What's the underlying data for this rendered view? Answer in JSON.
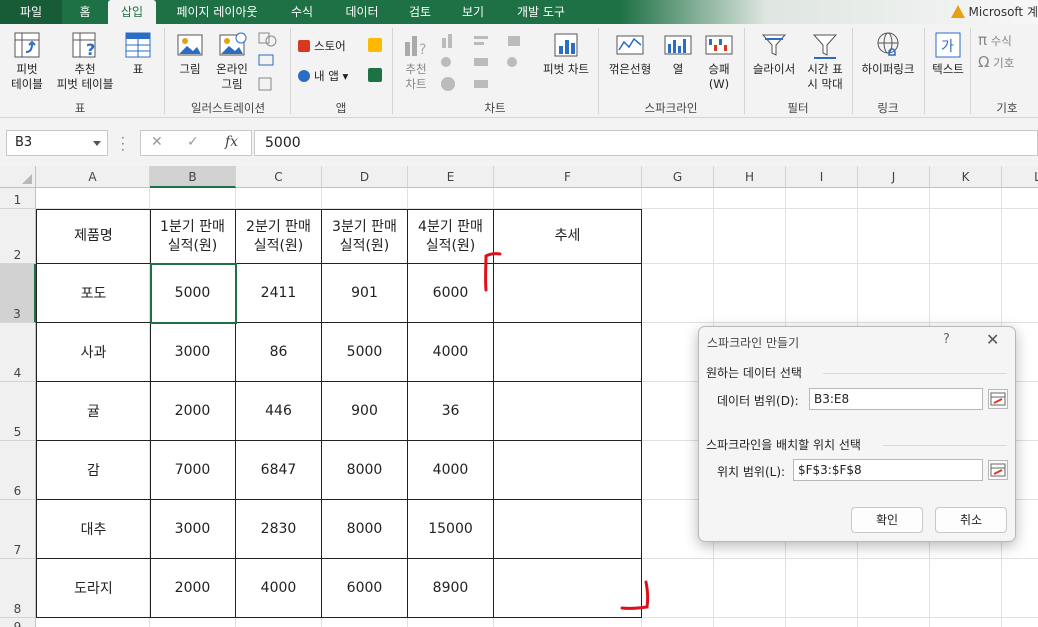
{
  "tabs": [
    {
      "label": "파일"
    },
    {
      "label": "홈"
    },
    {
      "label": "삽입"
    },
    {
      "label": "페이지 레이아웃"
    },
    {
      "label": "수식"
    },
    {
      "label": "데이터"
    },
    {
      "label": "검토"
    },
    {
      "label": "보기"
    },
    {
      "label": "개발 도구"
    }
  ],
  "active_tab": "삽입",
  "account": "Microsoft 계",
  "ribbon": {
    "pivot_table": "피벗\n테이블",
    "recommended_pivot": "추천\n피벗 테이블",
    "table": "표",
    "grp_table": "표",
    "picture": "그림",
    "online_picture": "온라인\n그림",
    "grp_illustration": "일러스트레이션",
    "store": "스토어",
    "my_apps": "내 앱",
    "grp_apps": "앱",
    "recommended_chart": "추천\n차트",
    "pivot_chart": "피벗 차트",
    "grp_chart": "차트",
    "line": "꺾은선형",
    "column": "열",
    "win_loss": "승패\n(W)",
    "grp_sparkline": "스파크라인",
    "slicer": "슬라이서",
    "timeline": "시간 표\n시 막대",
    "grp_filter": "필터",
    "hyperlink": "하이퍼링크",
    "grp_link": "링크",
    "text": "텍스트",
    "equation": "수식",
    "symbol": "기호",
    "grp_symbol": "기호"
  },
  "formula_bar": {
    "name_box": "B3",
    "formula": "5000",
    "fx": "fx"
  },
  "columns": [
    "A",
    "B",
    "C",
    "D",
    "E",
    "F",
    "G",
    "H",
    "I",
    "J",
    "K",
    "L"
  ],
  "rows": [
    "1",
    "2",
    "3",
    "4",
    "5",
    "6",
    "7",
    "8",
    "9"
  ],
  "table": {
    "headers": [
      "제품명",
      "1분기 판매\n실적(원)",
      "2분기 판매\n실적(원)",
      "3분기 판매\n실적(원)",
      "4분기 판매\n실적(원)",
      "추세"
    ],
    "rows": [
      [
        "포도",
        "5000",
        "2411",
        "901",
        "6000",
        ""
      ],
      [
        "사과",
        "3000",
        "86",
        "5000",
        "4000",
        ""
      ],
      [
        "귤",
        "2000",
        "446",
        "900",
        "36",
        ""
      ],
      [
        "감",
        "7000",
        "6847",
        "8000",
        "4000",
        ""
      ],
      [
        "대추",
        "3000",
        "2830",
        "8000",
        "15000",
        ""
      ],
      [
        "도라지",
        "2000",
        "4000",
        "6000",
        "8900",
        ""
      ]
    ]
  },
  "dialog": {
    "title": "스파크라인 만들기",
    "help": "?",
    "close": "✕",
    "section_data": "원하는 데이터 선택",
    "data_range_label": "데이터 범위(D):",
    "data_range_value": "B3:E8",
    "section_location": "스파크라인을 배치할 위치 선택",
    "location_label": "위치 범위(L):",
    "location_value": "$F$3:$F$8",
    "ok": "확인",
    "cancel": "취소"
  },
  "colors": {
    "excel_green": "#1e7145",
    "annotation_red": "#e0101a"
  }
}
